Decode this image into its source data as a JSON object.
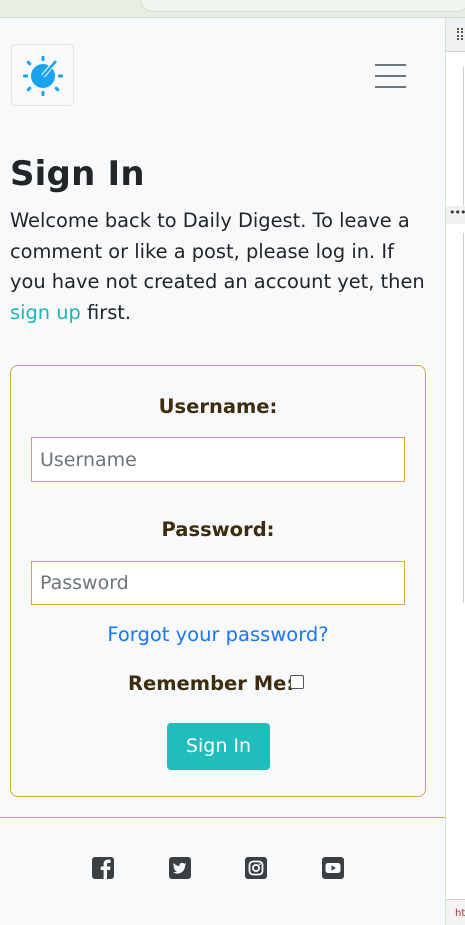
{
  "nav": {
    "logo_icon": "gauge-logo-icon",
    "logo_color": "#1aa3f0",
    "menu_icon": "hamburger-icon"
  },
  "page": {
    "title": "Sign In",
    "intro_before": "Welcome back to Daily Digest. To leave a comment or like a post, please log in. If you have not created an account yet, then ",
    "intro_link": "sign up",
    "intro_after": " first."
  },
  "form": {
    "username_label": "Username:",
    "username_placeholder": "Username",
    "username_value": "",
    "password_label": "Password:",
    "password_placeholder": "Password",
    "password_value": "",
    "forgot_link": "Forgot your password?",
    "remember_label": "Remember Me:",
    "remember_checked": false,
    "submit_label": "Sign In"
  },
  "footer": {
    "social": [
      {
        "name": "facebook",
        "icon": "facebook-icon"
      },
      {
        "name": "twitter",
        "icon": "twitter-icon"
      },
      {
        "name": "instagram",
        "icon": "instagram-icon"
      },
      {
        "name": "youtube",
        "icon": "youtube-icon"
      }
    ]
  },
  "colors": {
    "accent": "#20bdbd",
    "border": "#d9a441",
    "link": "#1877f2"
  }
}
